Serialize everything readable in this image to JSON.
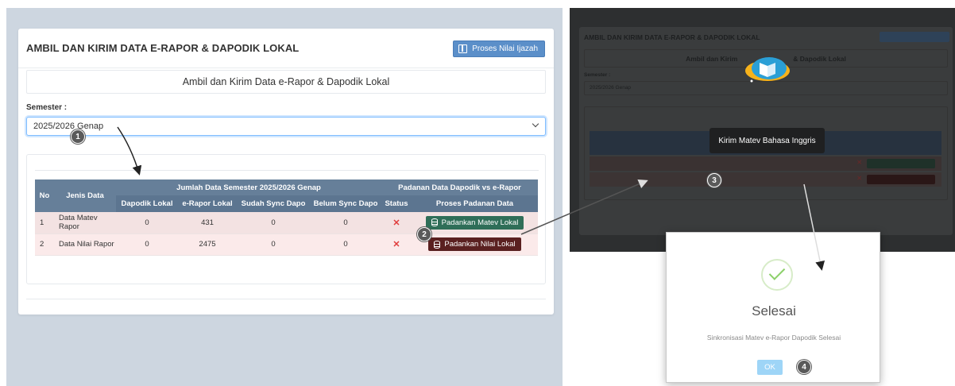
{
  "left": {
    "card_title": "AMBIL DAN KIRIM DATA E-RAPOR & DAPODIK LOKAL",
    "btn_ijazah": "Proses Nilai Ijazah",
    "subheader": "Ambil dan Kirim Data e-Rapor & Dapodik Lokal",
    "semester_label": "Semester :",
    "semester_value": "2025/2026 Genap",
    "table": {
      "col_no": "No",
      "col_jenis": "Jenis Data",
      "group_jumlah": "Jumlah Data Semester 2025/2026 Genap",
      "group_padanan": "Padanan Data Dapodik vs e-Rapor",
      "sub_dapodik": "Dapodik Lokal",
      "sub_erapor": "e-Rapor Lokal",
      "sub_sudah": "Sudah Sync Dapo",
      "sub_belum": "Belum Sync Dapo",
      "sub_status": "Status",
      "sub_proses": "Proses Padanan Data",
      "rows": [
        {
          "no": "1",
          "jenis": "Data Matev Rapor",
          "dapodik": "0",
          "erapor": "431",
          "sudah": "0",
          "belum": "0",
          "status": "✕",
          "button": "Padankan Matev Lokal"
        },
        {
          "no": "2",
          "jenis": "Data Nilai Rapor",
          "dapodik": "0",
          "erapor": "2475",
          "sudah": "0",
          "belum": "0",
          "status": "✕",
          "button": "Padankan Nilai Lokal"
        }
      ]
    }
  },
  "right": {
    "card_title": "AMBIL DAN KIRIM DATA E-RAPOR & DAPODIK LOKAL",
    "subheader_left": "Ambil dan Kirim",
    "subheader_right": "& Dapodik Lokal",
    "semester_label": "Semester :",
    "semester_value": "2025/2026 Genap",
    "tooltip": "Kirim Matev Bahasa Inggris"
  },
  "modal": {
    "title": "Selesai",
    "message": "Sinkronisasi Matev e-Rapor Dapodik Selesai",
    "ok": "OK"
  },
  "markers": {
    "m1": "1",
    "m2": "2",
    "m3": "3",
    "m4": "4"
  },
  "colors": {
    "accent_blue": "#5b8fc9",
    "table_header": "#667f99",
    "btn_green": "#2f6e58",
    "btn_maroon": "#5a2020",
    "status_x": "#e03b3b",
    "success_check": "#8cd06a",
    "ok_button": "#9ed5f7"
  }
}
